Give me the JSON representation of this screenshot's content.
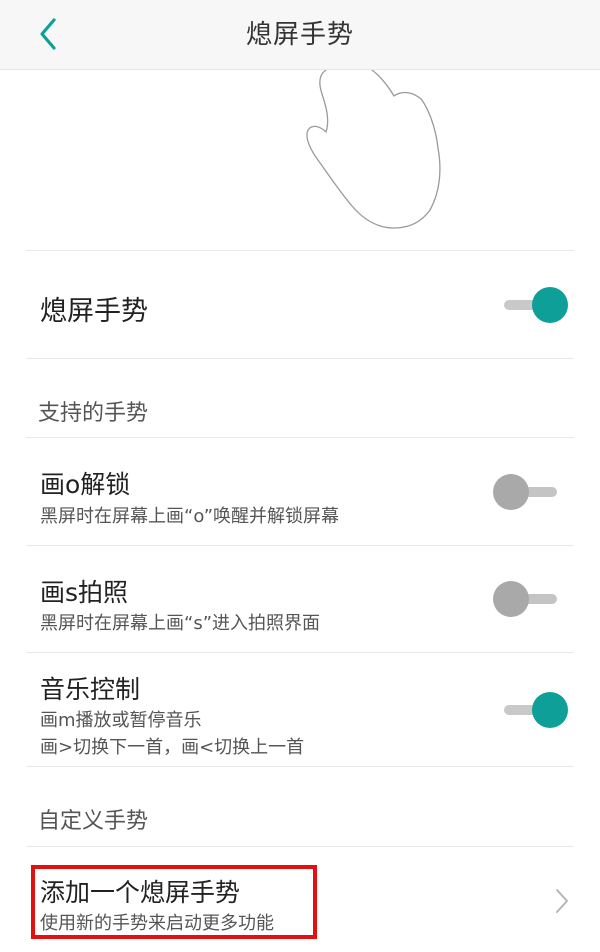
{
  "header": {
    "title": "熄屏手势"
  },
  "main_toggle": {
    "label": "熄屏手势",
    "state": "on"
  },
  "sections": {
    "supported": "支持的手势",
    "custom": "自定义手势"
  },
  "gestures": [
    {
      "title": "画o解锁",
      "desc": "黑屏时在屏幕上画“o”唤醒并解锁屏幕",
      "state": "off"
    },
    {
      "title": "画s拍照",
      "desc": "黑屏时在屏幕上画“s”进入拍照界面",
      "state": "off"
    },
    {
      "title": "音乐控制",
      "desc_line1": "画m播放或暂停音乐",
      "desc_line2": "画>切换下一首，画<切换上一首",
      "state": "on"
    }
  ],
  "add_gesture": {
    "title": "添加一个熄屏手势",
    "desc": "使用新的手势来启动更多功能"
  },
  "colors": {
    "accent": "#0e9f99",
    "highlight": "#e31010",
    "toggle_off": "#a9a9a9"
  },
  "icons": {
    "back": "back-arrow-icon",
    "hand": "hand-illustration",
    "chevron": "chevron-right-icon"
  }
}
